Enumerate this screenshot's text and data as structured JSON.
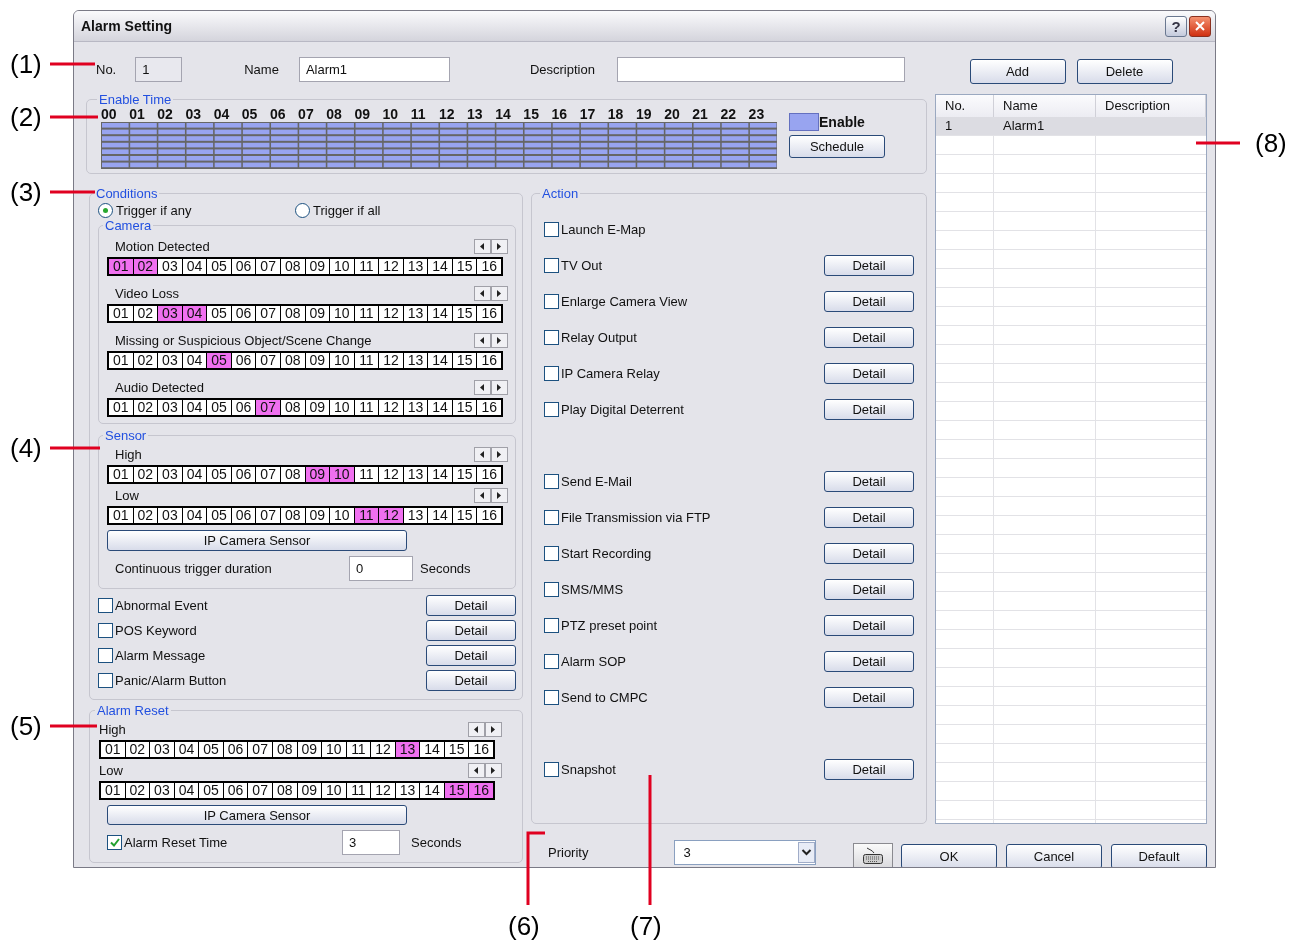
{
  "window": {
    "title": "Alarm Setting",
    "help_button": "?"
  },
  "header": {
    "no_label": "No.",
    "no_value": "1",
    "name_label": "Name",
    "name_value": "Alarm1",
    "description_label": "Description"
  },
  "enable_time": {
    "legend": "Enable Time",
    "hours": [
      "00",
      "01",
      "02",
      "03",
      "04",
      "05",
      "06",
      "07",
      "08",
      "09",
      "10",
      "11",
      "12",
      "13",
      "14",
      "15",
      "16",
      "17",
      "18",
      "19",
      "20",
      "21",
      "22",
      "23"
    ],
    "enable_label": "Enable",
    "schedule_button": "Schedule"
  },
  "list_buttons": [
    "Add",
    "Delete"
  ],
  "alarm_table": {
    "columns": [
      "No.",
      "Name",
      "Description"
    ],
    "rows": [
      {
        "cells": [
          "1",
          "Alarm1"
        ],
        "selected": true
      }
    ]
  },
  "conditions": {
    "legend": "Conditions",
    "triggers": [
      {
        "label": "Trigger if any",
        "selected": true
      },
      {
        "label": "Trigger if all",
        "selected": false
      }
    ],
    "camera": {
      "legend": "Camera",
      "rows": [
        {
          "label": "Motion Detected",
          "channels": [
            {
              "label": "01",
              "selected": true
            },
            {
              "label": "02",
              "selected": true
            },
            {
              "label": "03",
              "selected": false
            },
            {
              "label": "04",
              "selected": false
            },
            {
              "label": "05",
              "selected": false
            },
            {
              "label": "06",
              "selected": false
            },
            {
              "label": "07",
              "selected": false
            },
            {
              "label": "08",
              "selected": false
            },
            {
              "label": "09",
              "selected": false
            },
            {
              "label": "10",
              "selected": false
            },
            {
              "label": "11",
              "selected": false
            },
            {
              "label": "12",
              "selected": false
            },
            {
              "label": "13",
              "selected": false
            },
            {
              "label": "14",
              "selected": false
            },
            {
              "label": "15",
              "selected": false
            },
            {
              "label": "16",
              "selected": false
            }
          ]
        },
        {
          "label": "Video Loss",
          "channels": [
            {
              "label": "01",
              "selected": false
            },
            {
              "label": "02",
              "selected": false
            },
            {
              "label": "03",
              "selected": true
            },
            {
              "label": "04",
              "selected": true
            },
            {
              "label": "05",
              "selected": false
            },
            {
              "label": "06",
              "selected": false
            },
            {
              "label": "07",
              "selected": false
            },
            {
              "label": "08",
              "selected": false
            },
            {
              "label": "09",
              "selected": false
            },
            {
              "label": "10",
              "selected": false
            },
            {
              "label": "11",
              "selected": false
            },
            {
              "label": "12",
              "selected": false
            },
            {
              "label": "13",
              "selected": false
            },
            {
              "label": "14",
              "selected": false
            },
            {
              "label": "15",
              "selected": false
            },
            {
              "label": "16",
              "selected": false
            }
          ]
        },
        {
          "label": "Missing or Suspicious Object/Scene Change",
          "channels": [
            {
              "label": "01",
              "selected": false
            },
            {
              "label": "02",
              "selected": false
            },
            {
              "label": "03",
              "selected": false
            },
            {
              "label": "04",
              "selected": false
            },
            {
              "label": "05",
              "selected": true
            },
            {
              "label": "06",
              "selected": false
            },
            {
              "label": "07",
              "selected": false
            },
            {
              "label": "08",
              "selected": false
            },
            {
              "label": "09",
              "selected": false
            },
            {
              "label": "10",
              "selected": false
            },
            {
              "label": "11",
              "selected": false
            },
            {
              "label": "12",
              "selected": false
            },
            {
              "label": "13",
              "selected": false
            },
            {
              "label": "14",
              "selected": false
            },
            {
              "label": "15",
              "selected": false
            },
            {
              "label": "16",
              "selected": false
            }
          ]
        },
        {
          "label": "Audio Detected",
          "channels": [
            {
              "label": "01",
              "selected": false
            },
            {
              "label": "02",
              "selected": false
            },
            {
              "label": "03",
              "selected": false
            },
            {
              "label": "04",
              "selected": false
            },
            {
              "label": "05",
              "selected": false
            },
            {
              "label": "06",
              "selected": false
            },
            {
              "label": "07",
              "selected": true
            },
            {
              "label": "08",
              "selected": false
            },
            {
              "label": "09",
              "selected": false
            },
            {
              "label": "10",
              "selected": false
            },
            {
              "label": "11",
              "selected": false
            },
            {
              "label": "12",
              "selected": false
            },
            {
              "label": "13",
              "selected": false
            },
            {
              "label": "14",
              "selected": false
            },
            {
              "label": "15",
              "selected": false
            },
            {
              "label": "16",
              "selected": false
            }
          ]
        }
      ]
    },
    "sensor": {
      "legend": "Sensor",
      "rows": [
        {
          "label": "High",
          "channels": [
            {
              "label": "01",
              "selected": false
            },
            {
              "label": "02",
              "selected": false
            },
            {
              "label": "03",
              "selected": false
            },
            {
              "label": "04",
              "selected": false
            },
            {
              "label": "05",
              "selected": false
            },
            {
              "label": "06",
              "selected": false
            },
            {
              "label": "07",
              "selected": false
            },
            {
              "label": "08",
              "selected": false
            },
            {
              "label": "09",
              "selected": true
            },
            {
              "label": "10",
              "selected": true
            },
            {
              "label": "11",
              "selected": false
            },
            {
              "label": "12",
              "selected": false
            },
            {
              "label": "13",
              "selected": false
            },
            {
              "label": "14",
              "selected": false
            },
            {
              "label": "15",
              "selected": false
            },
            {
              "label": "16",
              "selected": false
            }
          ]
        },
        {
          "label": "Low",
          "channels": [
            {
              "label": "01",
              "selected": false
            },
            {
              "label": "02",
              "selected": false
            },
            {
              "label": "03",
              "selected": false
            },
            {
              "label": "04",
              "selected": false
            },
            {
              "label": "05",
              "selected": false
            },
            {
              "label": "06",
              "selected": false
            },
            {
              "label": "07",
              "selected": false
            },
            {
              "label": "08",
              "selected": false
            },
            {
              "label": "09",
              "selected": false
            },
            {
              "label": "10",
              "selected": false
            },
            {
              "label": "11",
              "selected": true
            },
            {
              "label": "12",
              "selected": true
            },
            {
              "label": "13",
              "selected": false
            },
            {
              "label": "14",
              "selected": false
            },
            {
              "label": "15",
              "selected": false
            },
            {
              "label": "16",
              "selected": false
            }
          ]
        }
      ],
      "ip_button": "IP Camera Sensor",
      "duration_label": "Continuous trigger duration",
      "duration_value": "0",
      "duration_unit": "Seconds"
    },
    "events": [
      {
        "label": "Abnormal Event",
        "checked": false,
        "detail": "Detail"
      },
      {
        "label": "POS Keyword",
        "checked": false,
        "detail": "Detail"
      },
      {
        "label": "Alarm Message",
        "checked": false,
        "detail": "Detail"
      },
      {
        "label": "Panic/Alarm Button",
        "checked": false,
        "detail": "Detail"
      }
    ]
  },
  "alarm_reset": {
    "legend": "Alarm Reset",
    "rows": [
      {
        "label": "High",
        "channels": [
          {
            "label": "01",
            "selected": false
          },
          {
            "label": "02",
            "selected": false
          },
          {
            "label": "03",
            "selected": false
          },
          {
            "label": "04",
            "selected": false
          },
          {
            "label": "05",
            "selected": false
          },
          {
            "label": "06",
            "selected": false
          },
          {
            "label": "07",
            "selected": false
          },
          {
            "label": "08",
            "selected": false
          },
          {
            "label": "09",
            "selected": false
          },
          {
            "label": "10",
            "selected": false
          },
          {
            "label": "11",
            "selected": false
          },
          {
            "label": "12",
            "selected": false
          },
          {
            "label": "13",
            "selected": true
          },
          {
            "label": "14",
            "selected": false
          },
          {
            "label": "15",
            "selected": false
          },
          {
            "label": "16",
            "selected": false
          }
        ]
      },
      {
        "label": "Low",
        "channels": [
          {
            "label": "01",
            "selected": false
          },
          {
            "label": "02",
            "selected": false
          },
          {
            "label": "03",
            "selected": false
          },
          {
            "label": "04",
            "selected": false
          },
          {
            "label": "05",
            "selected": false
          },
          {
            "label": "06",
            "selected": false
          },
          {
            "label": "07",
            "selected": false
          },
          {
            "label": "08",
            "selected": false
          },
          {
            "label": "09",
            "selected": false
          },
          {
            "label": "10",
            "selected": false
          },
          {
            "label": "11",
            "selected": false
          },
          {
            "label": "12",
            "selected": false
          },
          {
            "label": "13",
            "selected": false
          },
          {
            "label": "14",
            "selected": false
          },
          {
            "label": "15",
            "selected": true
          },
          {
            "label": "16",
            "selected": true
          }
        ]
      }
    ],
    "ip_button": "IP Camera Sensor",
    "reset_time": {
      "label": "Alarm Reset Time",
      "checked": true
    },
    "value": "3",
    "unit": "Seconds"
  },
  "action": {
    "legend": "Action",
    "groups": [
      [
        {
          "label": "Launch E-Map",
          "checked": false
        },
        {
          "label": "TV Out",
          "checked": false,
          "detail": "Detail"
        },
        {
          "label": "Enlarge Camera View",
          "checked": false,
          "detail": "Detail"
        },
        {
          "label": "Relay Output",
          "checked": false,
          "detail": "Detail"
        },
        {
          "label": "IP Camera Relay",
          "checked": false,
          "detail": "Detail"
        },
        {
          "label": "Play Digital Deterrent",
          "checked": false,
          "detail": "Detail"
        }
      ],
      [
        {
          "label": "Send E-Mail",
          "checked": false,
          "detail": "Detail"
        },
        {
          "label": "File Transmission via FTP",
          "checked": false,
          "detail": "Detail"
        },
        {
          "label": "Start Recording",
          "checked": false,
          "detail": "Detail"
        },
        {
          "label": "SMS/MMS",
          "checked": false,
          "detail": "Detail"
        },
        {
          "label": "PTZ preset point",
          "checked": false,
          "detail": "Detail"
        },
        {
          "label": "Alarm SOP",
          "checked": false,
          "detail": "Detail"
        },
        {
          "label": "Send to CMPC",
          "checked": false,
          "detail": "Detail"
        }
      ],
      [
        {
          "label": "Snapshot",
          "checked": false,
          "detail": "Detail"
        }
      ]
    ]
  },
  "priority": {
    "label": "Priority",
    "value": "3"
  },
  "dialog_buttons": [
    "OK",
    "Cancel",
    "Default"
  ],
  "callouts": [
    "(1)",
    "(2)",
    "(3)",
    "(4)",
    "(5)",
    "(6)",
    "(7)",
    "(8)"
  ]
}
